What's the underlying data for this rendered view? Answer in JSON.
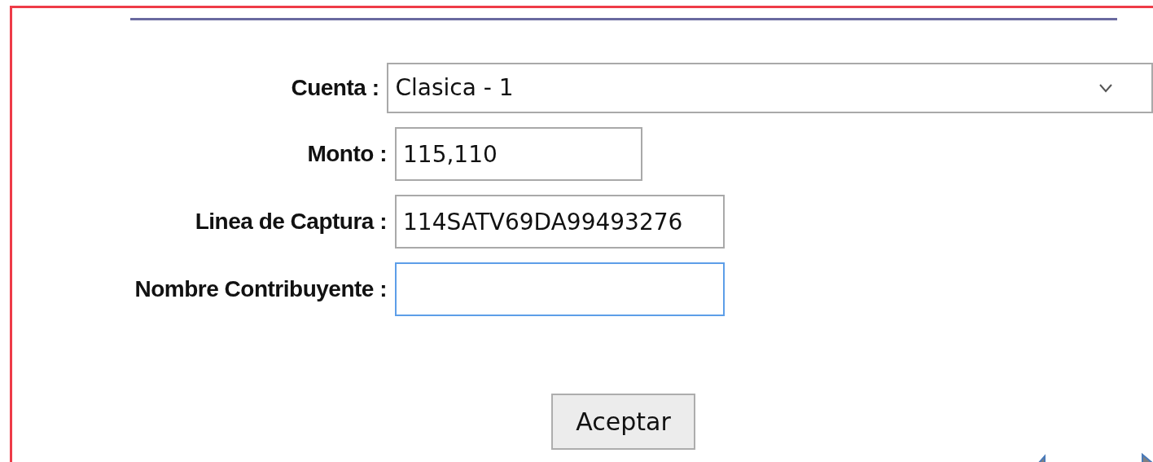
{
  "form": {
    "fields": [
      {
        "kind": "select",
        "label": "Cuenta :",
        "value": "Clasica - 1",
        "focused": false
      },
      {
        "kind": "amount",
        "label": "Monto :",
        "value": "115,110",
        "focused": false
      },
      {
        "kind": "text",
        "label": "Linea de Captura :",
        "value": "114SATV69DA99493276",
        "focused": false
      },
      {
        "kind": "text",
        "label": "Nombre Contribuyente :",
        "focused": true
      }
    ],
    "submit": "Aceptar"
  }
}
